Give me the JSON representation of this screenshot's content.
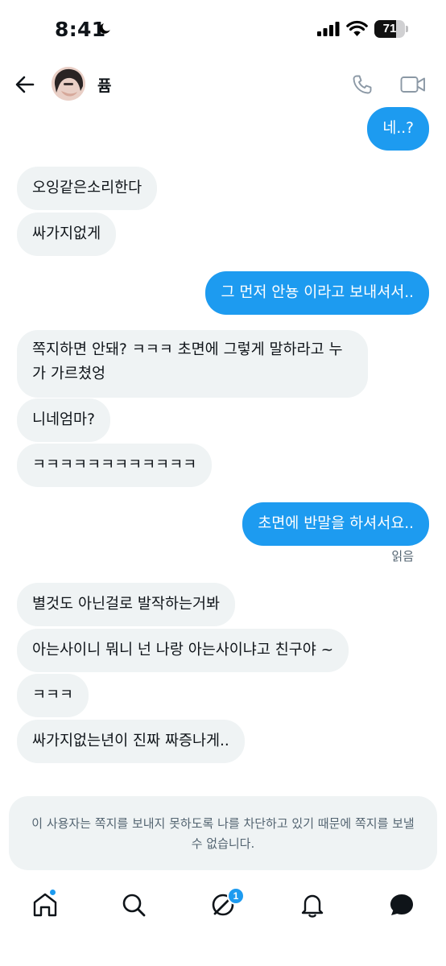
{
  "status_bar": {
    "time": "8:41",
    "battery_percent": 71,
    "battery_text": "71"
  },
  "header": {
    "contact_name": "퓸",
    "back_icon": "back-arrow-icon",
    "call_icon": "phone-icon",
    "video_icon": "video-camera-icon"
  },
  "messages": [
    {
      "direction": "sent",
      "text": "네..?"
    },
    {
      "direction": "received",
      "text": "오잉같은소리한다"
    },
    {
      "direction": "received",
      "text": "싸가지없게"
    },
    {
      "direction": "sent",
      "text": "그 먼저 안뇽 이라고 보내셔서.."
    },
    {
      "direction": "received",
      "text": "쪽지하면 안돼? ㅋㅋㅋ 초면에 그렇게 말하라고 누가 가르쳤엉"
    },
    {
      "direction": "received",
      "text": "니네엄마?"
    },
    {
      "direction": "received",
      "text": "ㅋㅋㅋㅋㅋㅋㅋㅋㅋㅋㅋㅋ"
    },
    {
      "direction": "sent",
      "text": "초면에 반말을 하셔서요.."
    },
    {
      "direction": "received",
      "text": "별것도 아닌걸로 발작하는거봐"
    },
    {
      "direction": "received",
      "text": "아는사이니 뭐니 넌 나랑 아는사이냐고 친구야 ~"
    },
    {
      "direction": "received",
      "text": "ㅋㅋㅋ"
    },
    {
      "direction": "received",
      "text": "싸가지없는년이 진짜 짜증나게.."
    }
  ],
  "read_receipt": "읽음",
  "blocked_notice": "이 사용자는 쪽지를 보내지 못하도록 나를 차단하고 있기 때문에 쪽지를 보낼 수 없습니다.",
  "bottom_nav": {
    "items": [
      "home-icon",
      "search-icon",
      "messages-icon",
      "notifications-icon",
      "grok-icon"
    ],
    "messages_badge": "1",
    "accent_color": "#1d9bf0"
  }
}
